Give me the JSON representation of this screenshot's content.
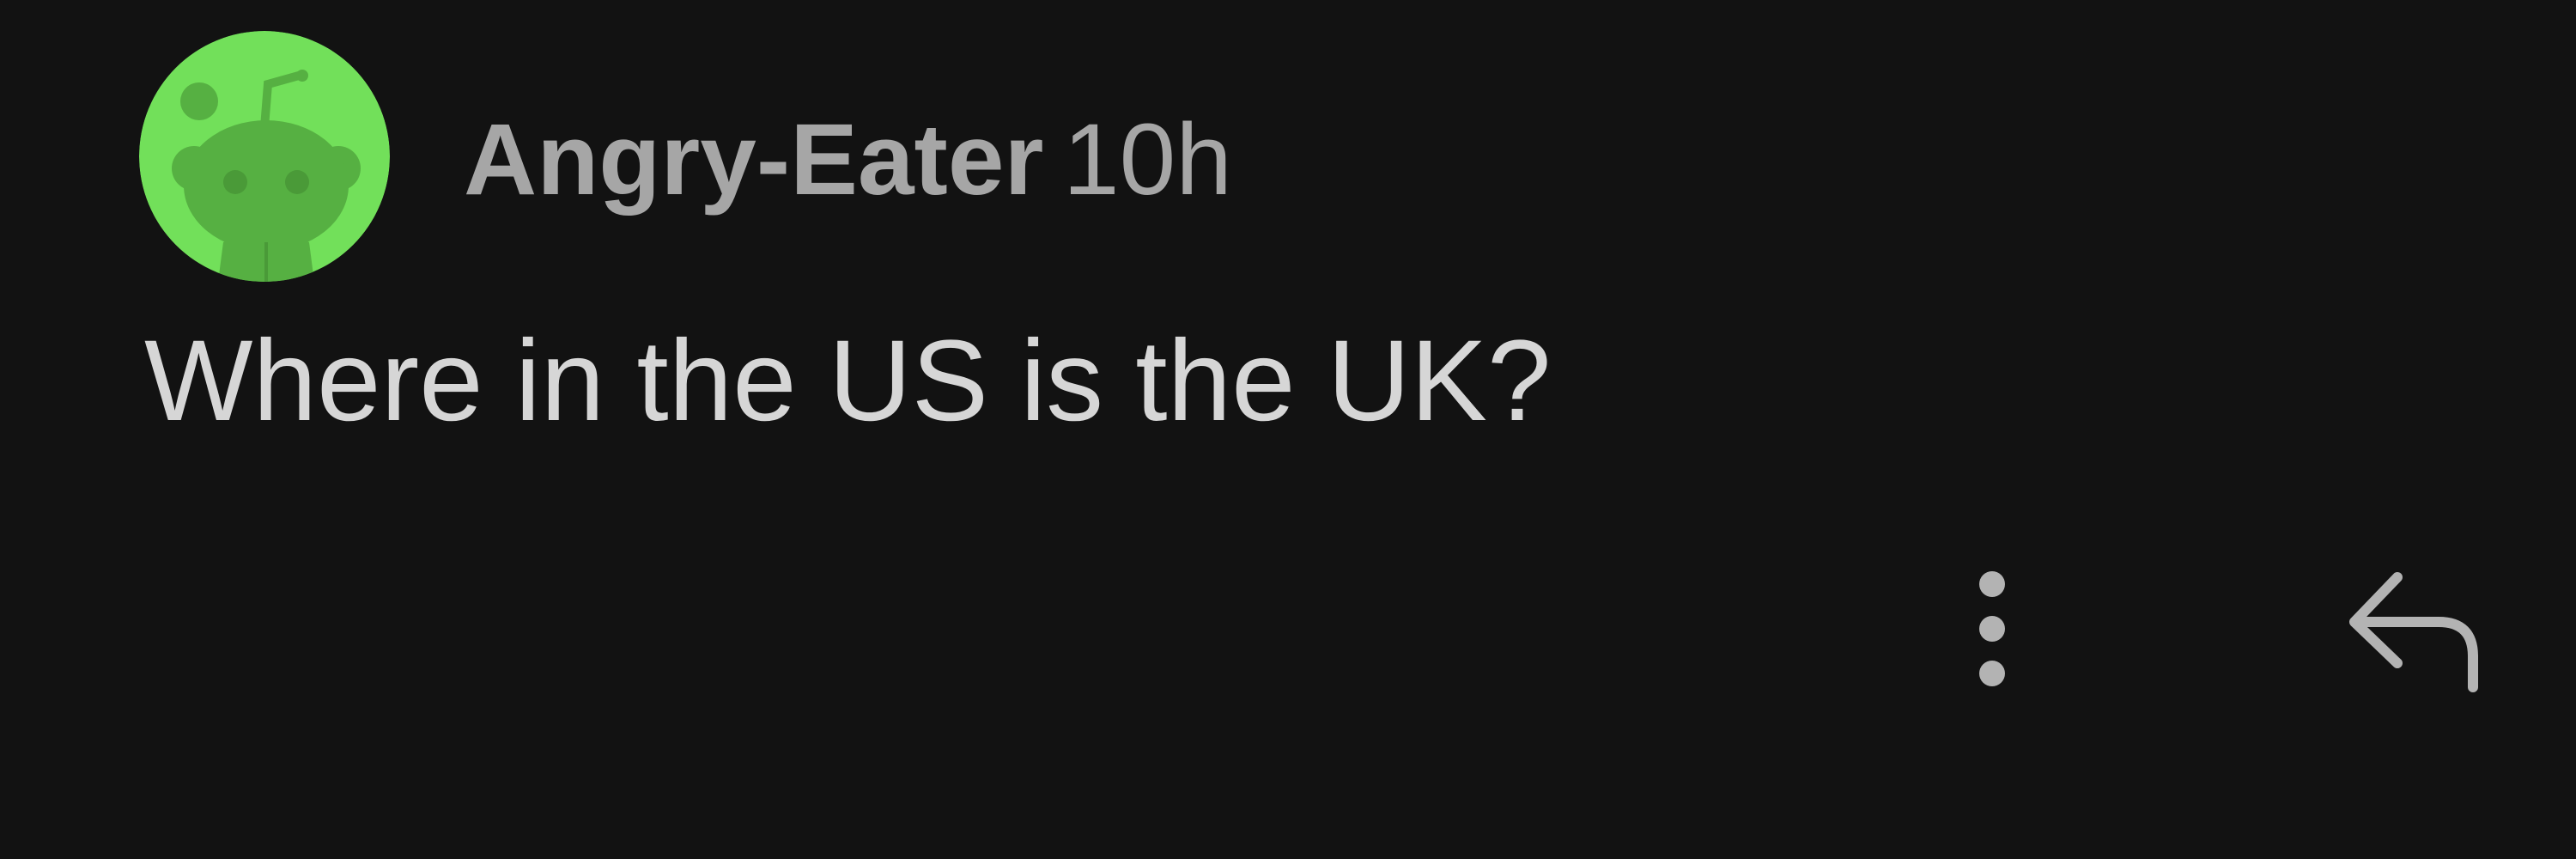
{
  "comment": {
    "username": "Angry-Eater",
    "timestamp": "10h",
    "body": "Where in the US is the UK?",
    "avatar_icon": "reddit-snoo-avatar-icon",
    "more_icon": "more-options-vertical-icon",
    "reply_icon": "reply-arrow-icon"
  },
  "colors": {
    "background": "#121212",
    "avatar_background": "#72e05a",
    "avatar_figure": "#56b042",
    "meta_text": "#a6a6a6",
    "body_text": "#d6d6d6",
    "icon": "#b3b3b3"
  }
}
